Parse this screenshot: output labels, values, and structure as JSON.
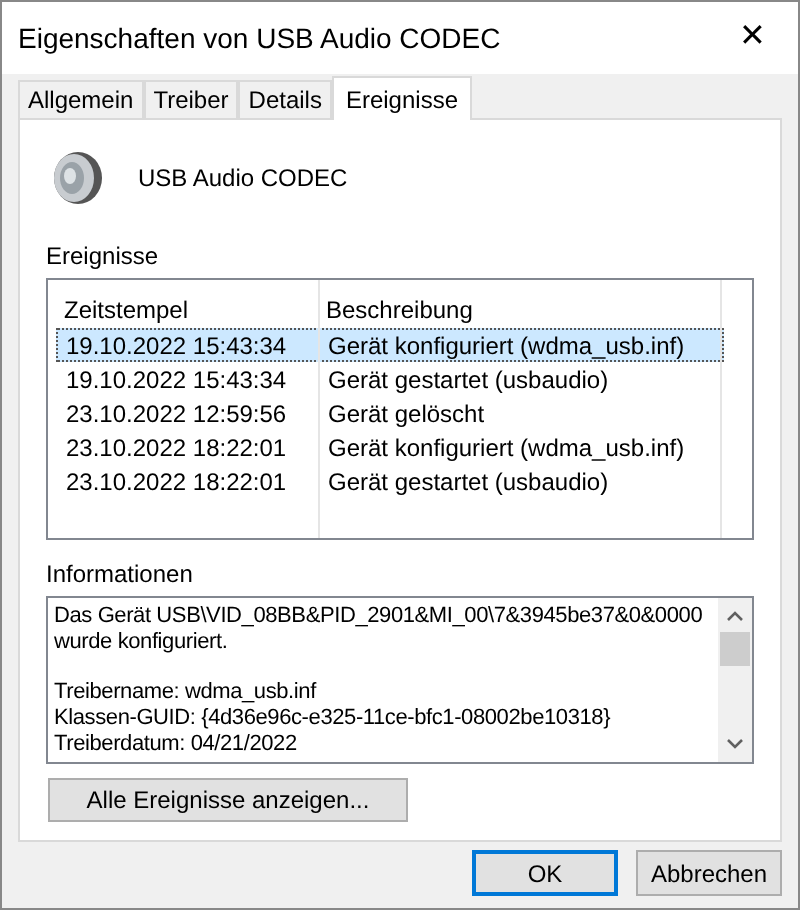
{
  "window": {
    "title": "Eigenschaften von USB Audio CODEC",
    "close": "✕"
  },
  "tabs": [
    {
      "label": "Allgemein",
      "selected": false
    },
    {
      "label": "Treiber",
      "selected": false
    },
    {
      "label": "Details",
      "selected": false
    },
    {
      "label": "Ereignisse",
      "selected": true
    }
  ],
  "device": {
    "name": "USB Audio CODEC"
  },
  "events": {
    "label": "Ereignisse",
    "columns": [
      "Zeitstempel",
      "Beschreibung"
    ],
    "rows": [
      {
        "time": "19.10.2022 15:43:34",
        "description": "Gerät konfiguriert (wdma_usb.inf)",
        "selected": true
      },
      {
        "time": "19.10.2022 15:43:34",
        "description": "Gerät gestartet (usbaudio)",
        "selected": false
      },
      {
        "time": "23.10.2022 12:59:56",
        "description": "Gerät gelöscht",
        "selected": false
      },
      {
        "time": "23.10.2022 18:22:01",
        "description": "Gerät konfiguriert (wdma_usb.inf)",
        "selected": false
      },
      {
        "time": "23.10.2022 18:22:01",
        "description": "Gerät gestartet (usbaudio)",
        "selected": false
      }
    ]
  },
  "information": {
    "label": "Informationen",
    "paragraphs": [
      [
        "Das Gerät USB\\VID_08BB&PID_2901&MI_00\\7&3945be37&0&0000",
        "wurde konfiguriert."
      ],
      [
        "Treibername: wdma_usb.inf",
        "Klassen-GUID: {4d36e96c-e325-11ce-bfc1-08002be10318}",
        "Treiberdatum: 04/21/2022"
      ]
    ]
  },
  "show_all_button": "Alle Ereignisse anzeigen...",
  "buttons": [
    {
      "label": "OK",
      "default": true
    },
    {
      "label": "Abbrechen",
      "default": false
    }
  ]
}
